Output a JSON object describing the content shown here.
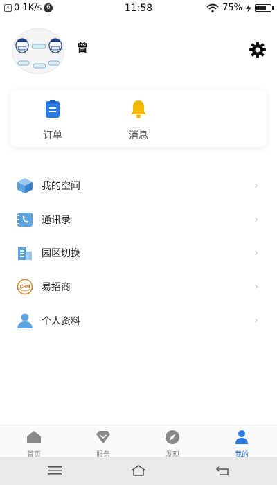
{
  "status_bar": {
    "speed": "0.1K/s",
    "badge": "6",
    "time": "11:58",
    "battery_percent": "75%",
    "battery_level": 0.75
  },
  "profile": {
    "name": "曾"
  },
  "quick_actions": [
    {
      "label": "订单",
      "icon": "clipboard-icon",
      "color": "#2a78e4"
    },
    {
      "label": "消息",
      "icon": "bell-icon",
      "color": "#f5b700"
    }
  ],
  "menu": [
    {
      "label": "我的空间",
      "icon": "cube-icon"
    },
    {
      "label": "通讯录",
      "icon": "contacts-icon"
    },
    {
      "label": "园区切换",
      "icon": "building-icon"
    },
    {
      "label": "易招商",
      "icon": "crm-logo-icon",
      "logo_text": "CRM"
    },
    {
      "label": "个人资料",
      "icon": "person-icon"
    }
  ],
  "tabs": [
    {
      "label": "首页",
      "icon": "home-icon",
      "active": false
    },
    {
      "label": "服务",
      "icon": "diamond-icon",
      "active": false
    },
    {
      "label": "发现",
      "icon": "compass-icon",
      "active": false
    },
    {
      "label": "我的",
      "icon": "user-icon",
      "active": true
    }
  ],
  "colors": {
    "accent": "#2a78e4",
    "bell": "#f5b700",
    "icon_blue": "#5ba3e0",
    "crm_orange": "#d9892b"
  }
}
